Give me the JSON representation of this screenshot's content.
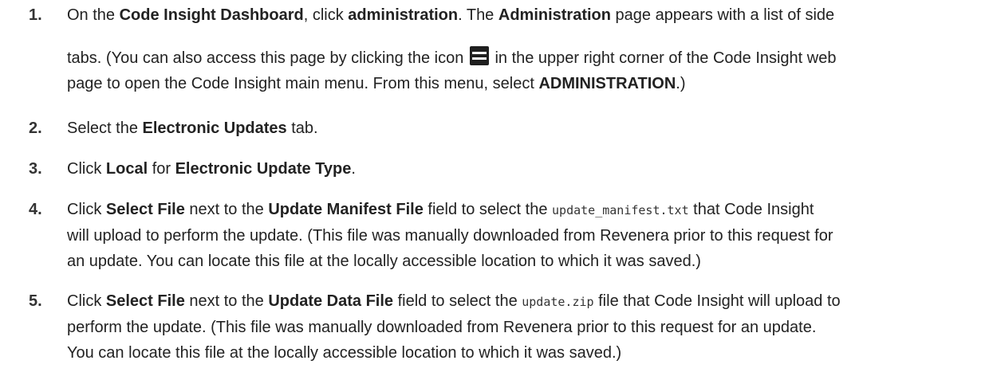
{
  "steps": [
    {
      "num": "1.",
      "t1": "On the ",
      "b1": "Code Insight Dashboard",
      "t2": ", click ",
      "b2": "administration",
      "t3": ". The ",
      "b3": "Administration",
      "t4": " page appears with a list of side",
      "t5": "tabs. (You can also access this page by clicking the icon ",
      "icon": "menu-icon",
      "t6": " in the upper right corner of the Code Insight web",
      "t7": "page to open the Code Insight main menu. From this menu, select ",
      "b4": "ADMINISTRATION",
      "t8": ".)"
    },
    {
      "num": "2.",
      "t1": "Select the ",
      "b1": "Electronic Updates",
      "t2": " tab."
    },
    {
      "num": "3.",
      "t1": "Click ",
      "b1": "Local",
      "t2": " for ",
      "b2": "Electronic Update Type",
      "t3": "."
    },
    {
      "num": "4.",
      "t1": "Click ",
      "b1": "Select File",
      "t2": " next to the ",
      "b2": "Update Manifest File",
      "t3": " field to select the ",
      "code": "update_manifest.txt",
      "t4": " that Code Insight",
      "t5": "will upload to perform the update. (This file was manually downloaded from Revenera prior to this request for",
      "t6": "an update. You can locate this file at the locally accessible location to which it was saved.)"
    },
    {
      "num": "5.",
      "t1": "Click ",
      "b1": "Select File",
      "t2": " next to the ",
      "b2": "Update Data File",
      "t3": " field to select the ",
      "code": "update.zip",
      "t4": " file that Code Insight will upload to",
      "t5": "perform the update. (This file was manually downloaded from Revenera prior to this request for an update.",
      "t6": "You can locate this file at the locally accessible location to which it was saved.)"
    }
  ]
}
